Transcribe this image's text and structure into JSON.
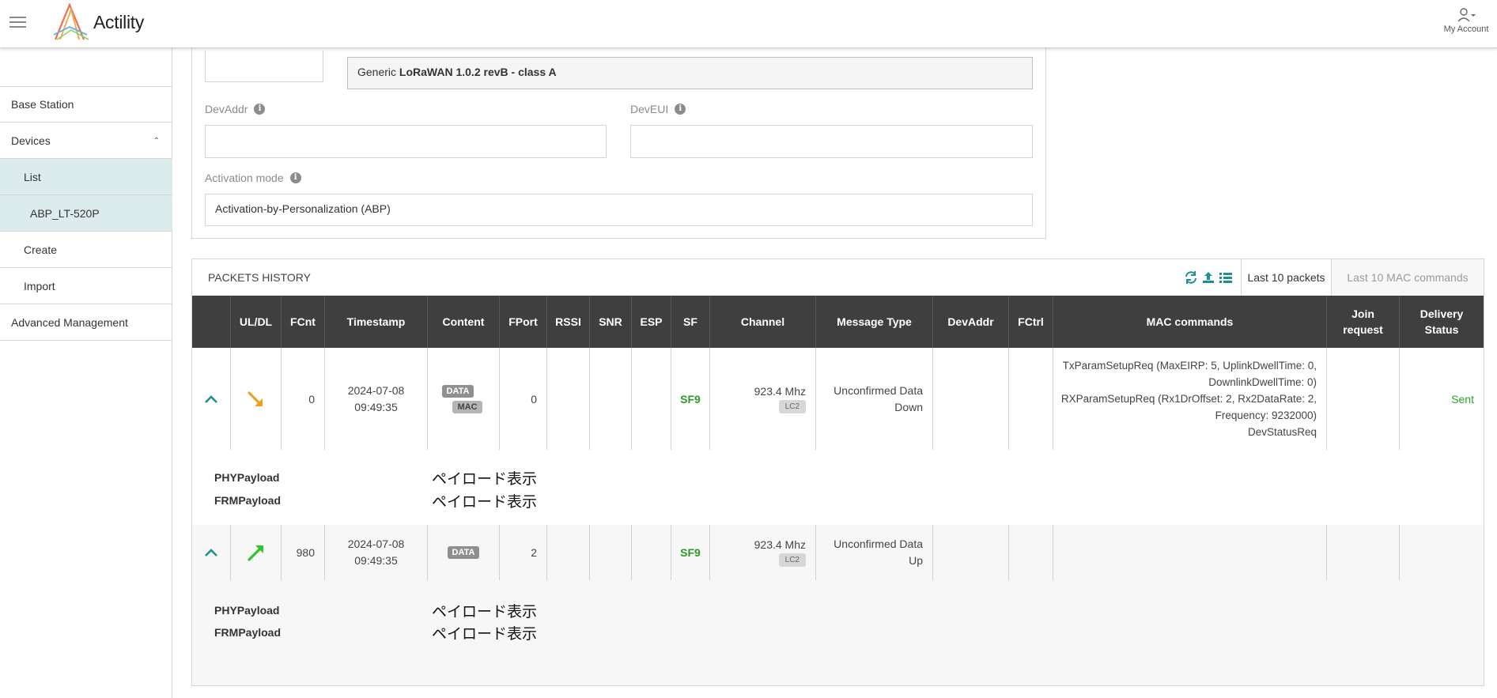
{
  "header": {
    "logo_text": "Actility",
    "account_label": "My Account"
  },
  "sidebar": {
    "items": [
      {
        "label": "Base Station"
      },
      {
        "label": "Devices"
      },
      {
        "label": "List"
      },
      {
        "label": "ABP_LT-520P"
      },
      {
        "label": "Create"
      },
      {
        "label": "Import"
      },
      {
        "label": "Advanced Management"
      }
    ]
  },
  "form": {
    "profile_prefix": "Generic ",
    "profile_bold": "LoRaWAN 1.0.2 revB - class A",
    "devaddr_label": "DevAddr",
    "deveui_label": "DevEUI",
    "activation_label": "Activation mode",
    "activation_value": "Activation-by-Personalization (ABP)"
  },
  "packets": {
    "title": "PACKETS HISTORY",
    "tabs": [
      {
        "label": "Last 10 packets",
        "active": true
      },
      {
        "label": "Last 10 MAC commands",
        "active": false
      }
    ],
    "columns": [
      "",
      "UL/DL",
      "FCnt",
      "Timestamp",
      "Content",
      "FPort",
      "RSSI",
      "SNR",
      "ESP",
      "SF",
      "Channel",
      "Message Type",
      "DevAddr",
      "FCtrl",
      "MAC commands",
      "Join request",
      "Delivery Status"
    ],
    "rows": [
      {
        "direction": "downlink",
        "fcnt": "0",
        "date": "2024-07-08",
        "time": "09:49:35",
        "content": [
          "DATA",
          "MAC"
        ],
        "fport": "0",
        "sf": "SF9",
        "channel": "923.4 Mhz",
        "channel_badge": "LC2",
        "message_type_l1": "Unconfirmed Data",
        "message_type_l2": "Down",
        "mac_commands": [
          "TxParamSetupReq (MaxEIRP: 5, UplinkDwellTime: 0,",
          "DownlinkDwellTime: 0)",
          "RXParamSetupReq (Rx1DrOffset: 2, Rx2DataRate: 2,",
          "Frequency: 9232000)",
          "DevStatusReq"
        ],
        "delivery_status": "Sent",
        "phy_label": "PHYPayload",
        "frm_label": "FRMPayload",
        "payload_link": "ペイロード表示"
      },
      {
        "direction": "uplink",
        "fcnt": "980",
        "date": "2024-07-08",
        "time": "09:49:35",
        "content": [
          "DATA"
        ],
        "fport": "2",
        "sf": "SF9",
        "channel": "923.4 Mhz",
        "channel_badge": "LC2",
        "message_type_l1": "Unconfirmed Data",
        "message_type_l2": "Up",
        "mac_commands": [],
        "delivery_status": "",
        "phy_label": "PHYPayload",
        "frm_label": "FRMPayload",
        "payload_link": "ペイロード表示"
      }
    ]
  },
  "colors": {
    "accent_teal": "#1f8f8f",
    "sf_green": "#2a9a2a",
    "downlink_orange": "#f0a020",
    "uplink_green": "#2ec42e",
    "header_dark": "#3f3f3f"
  }
}
